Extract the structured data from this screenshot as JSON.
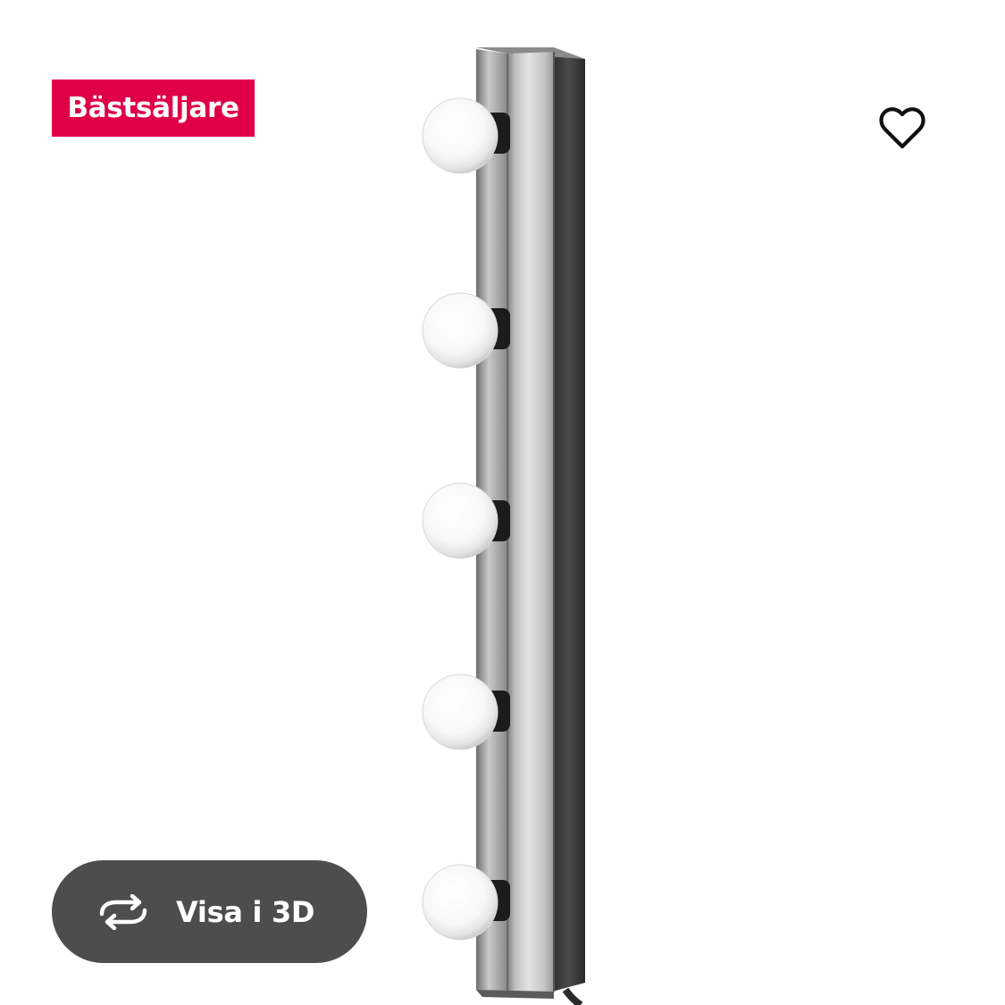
{
  "product": {
    "badge_label": "Bästsäljare",
    "image_icon": "wall-lamp-bar-with-five-bulbs"
  },
  "actions": {
    "favourite_icon": "heart-outline-icon",
    "view_3d_label": "Visa i 3D",
    "view_3d_icon": "rotate-arrows-icon"
  },
  "colors": {
    "badge_bg": "#e0004a",
    "button_bg": "#4d4d4d",
    "background": "#ffffff"
  }
}
